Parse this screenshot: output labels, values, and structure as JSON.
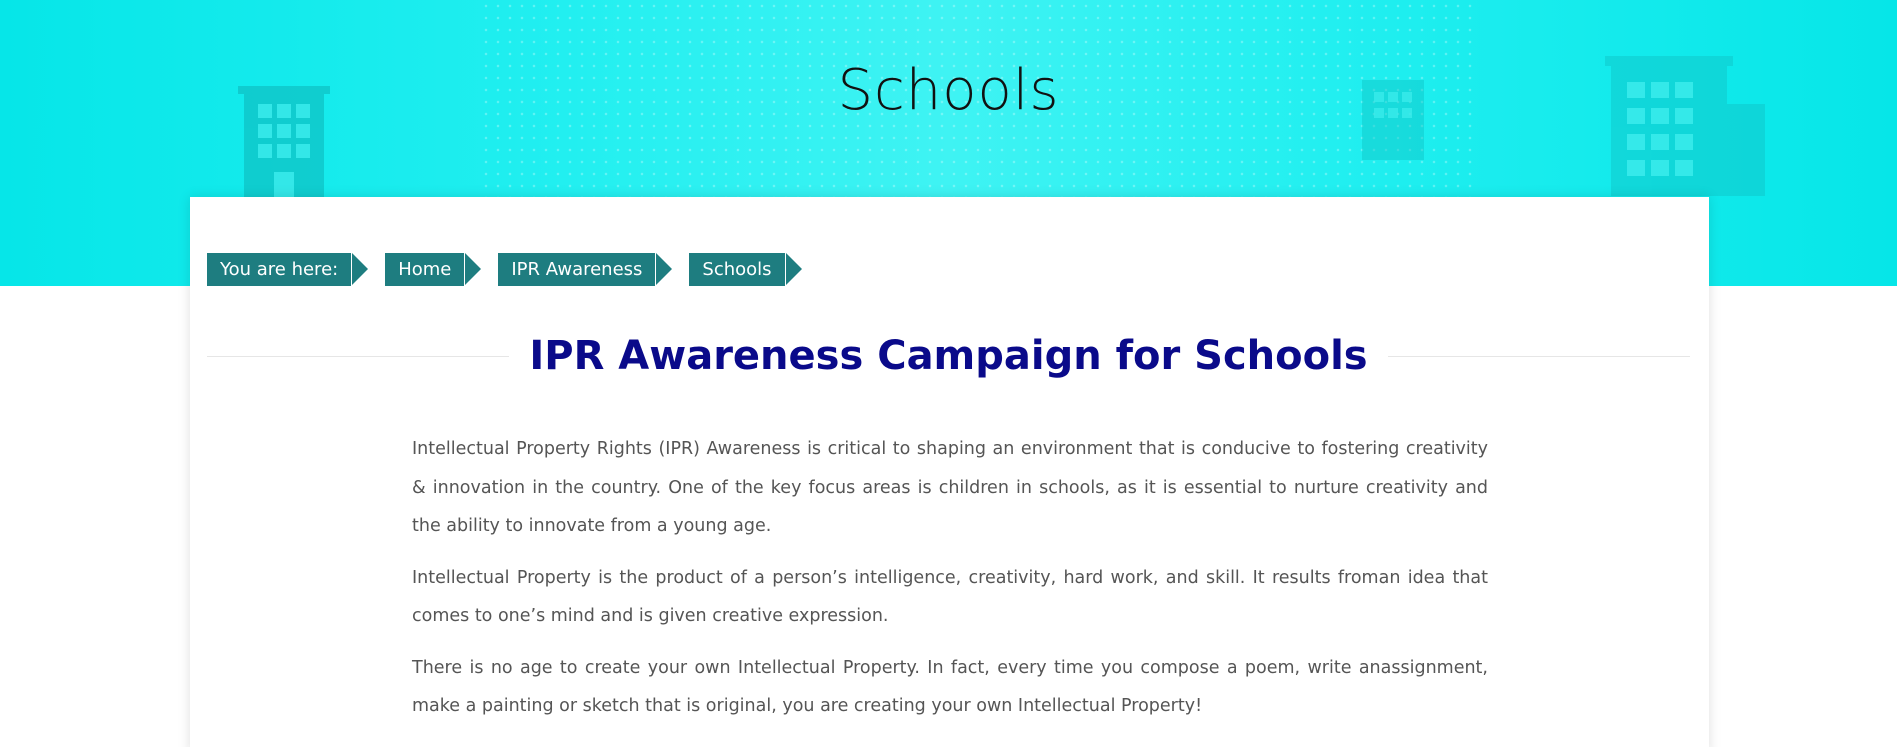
{
  "hero": {
    "title": "Schools"
  },
  "breadcrumb": {
    "prefix": "You are here:",
    "items": [
      {
        "label": "Home"
      },
      {
        "label": "IPR Awareness"
      },
      {
        "label": "Schools"
      }
    ]
  },
  "main": {
    "heading": "IPR Awareness Campaign for Schools",
    "paragraphs": [
      "Intellectual Property Rights (IPR) Awareness is critical to shaping an environment that is conducive to fostering creativity & innovation in the country. One of the key focus areas is children in schools, as it is essential to nurture creativity and the ability to innovate from a young age.",
      "Intellectual Property is the product of a person’s intelligence, creativity, hard work, and skill. It results froman idea that comes to one’s mind and is given creative expression.",
      "There is no age to create your own Intellectual Property. In fact, every time you compose a poem, write anassignment, make a painting or sketch that is original, you are creating your own Intellectual Property!"
    ]
  },
  "colors": {
    "hero_bg": "#06e6e8",
    "breadcrumb_bg": "#1e7d80",
    "heading": "#0a0a8a",
    "body_text": "#555555"
  },
  "icons": [
    "building-icon",
    "building-icon",
    "building-icon"
  ]
}
